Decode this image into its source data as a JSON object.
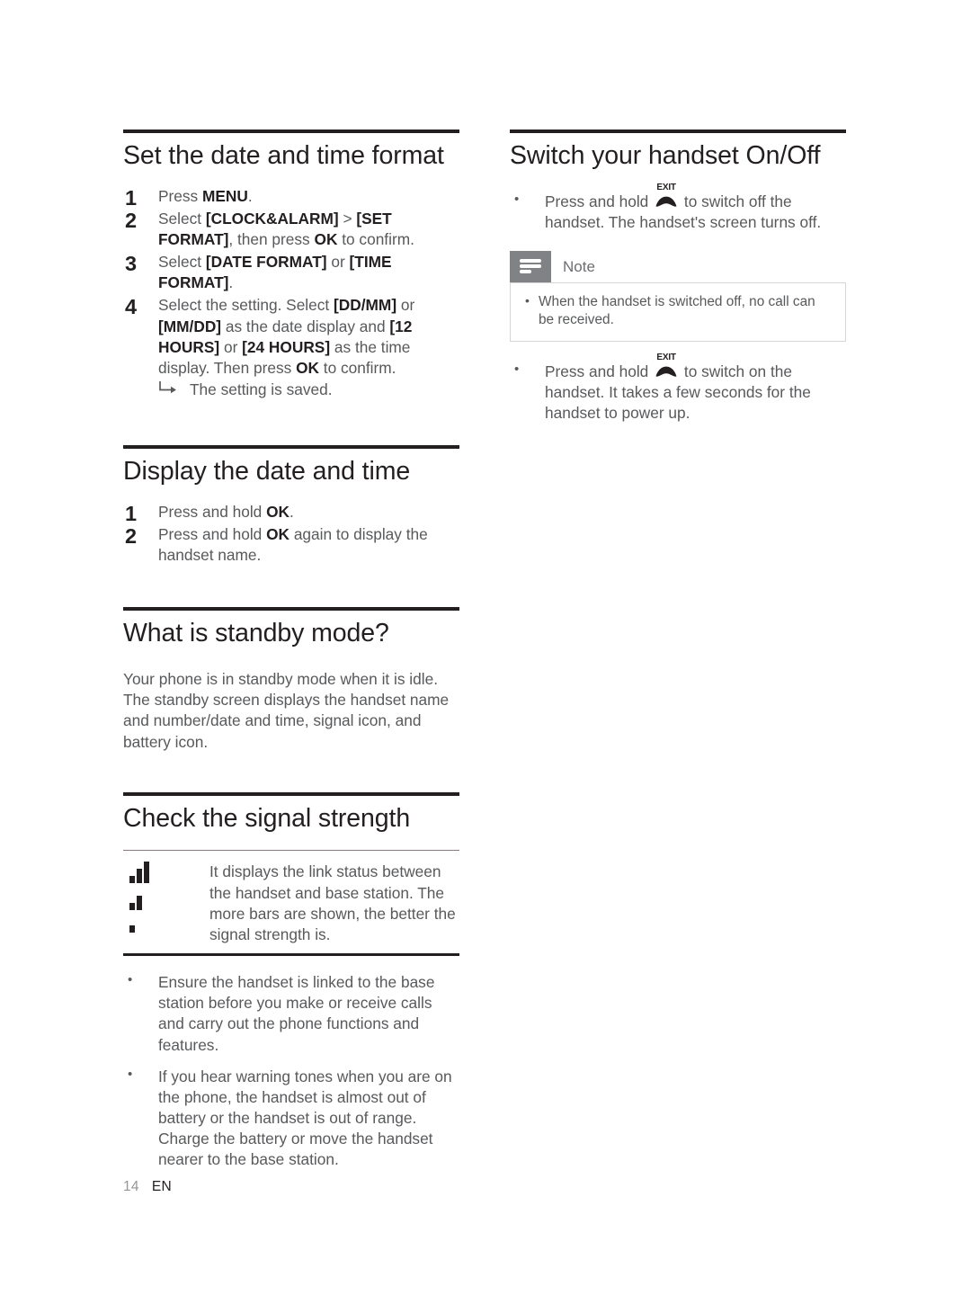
{
  "page": {
    "number": "14",
    "language": "EN"
  },
  "left_column": {
    "sections": [
      {
        "id": "set-date-time-format",
        "heading": "Set the date and time format",
        "steps": [
          {
            "num": "1",
            "parts": [
              {
                "text": "Press ",
                "bold": false
              },
              {
                "text": "MENU",
                "bold": true
              },
              {
                "text": ".",
                "bold": false
              }
            ]
          },
          {
            "num": "2",
            "parts": [
              {
                "text": "Select ",
                "bold": false
              },
              {
                "text": "[CLOCK&ALARM]",
                "bold": true
              },
              {
                "text": " > ",
                "bold": false
              },
              {
                "text": "[SET FORMAT]",
                "bold": true
              },
              {
                "text": ", then press ",
                "bold": false
              },
              {
                "text": "OK",
                "bold": true
              },
              {
                "text": " to confirm.",
                "bold": false
              }
            ]
          },
          {
            "num": "3",
            "parts": [
              {
                "text": "Select ",
                "bold": false
              },
              {
                "text": "[DATE FORMAT]",
                "bold": true
              },
              {
                "text": " or ",
                "bold": false
              },
              {
                "text": "[TIME FORMAT]",
                "bold": true
              },
              {
                "text": ".",
                "bold": false
              }
            ]
          },
          {
            "num": "4",
            "parts": [
              {
                "text": "Select the setting. Select ",
                "bold": false
              },
              {
                "text": "[DD/MM]",
                "bold": true
              },
              {
                "text": " or ",
                "bold": false
              },
              {
                "text": "[MM/DD]",
                "bold": true
              },
              {
                "text": " as the date display and ",
                "bold": false
              },
              {
                "text": "[12 HOURS]",
                "bold": true
              },
              {
                "text": " or ",
                "bold": false
              },
              {
                "text": "[24 HOURS]",
                "bold": true
              },
              {
                "text": " as the time display. Then press ",
                "bold": false
              },
              {
                "text": "OK",
                "bold": true
              },
              {
                "text": " to confirm.",
                "bold": false
              }
            ],
            "result": "The setting is saved."
          }
        ]
      },
      {
        "id": "display-date-time",
        "heading": "Display the date and time",
        "steps": [
          {
            "num": "1",
            "parts": [
              {
                "text": "Press and hold ",
                "bold": false
              },
              {
                "text": "OK",
                "bold": true
              },
              {
                "text": ".",
                "bold": false
              }
            ]
          },
          {
            "num": "2",
            "parts": [
              {
                "text": "Press and hold ",
                "bold": false
              },
              {
                "text": "OK",
                "bold": true
              },
              {
                "text": " again to display the handset name.",
                "bold": false
              }
            ]
          }
        ]
      },
      {
        "id": "standby-mode",
        "heading": "What is standby mode?",
        "paragraph": "Your phone is in standby mode when it is idle. The standby screen displays the handset name and number/date and time, signal icon, and battery icon."
      },
      {
        "id": "check-signal-strength",
        "heading": "Check the signal strength",
        "signal_table": {
          "icons": [
            {
              "name": "signal-strength-3-bars",
              "bars": 3
            },
            {
              "name": "signal-strength-2-bars",
              "bars": 2
            },
            {
              "name": "signal-strength-1-bar",
              "bars": 1
            }
          ],
          "description": "It displays the link status between the handset and base station. The more bars are shown, the better the signal strength is."
        },
        "bullets": [
          "Ensure the handset is linked to the base station before you make or receive calls and carry out the phone functions and features.",
          "If you hear warning tones when you are on the phone, the handset is almost out of battery or the handset is out of range. Charge the battery or move the handset nearer to the base station."
        ]
      }
    ]
  },
  "right_column": {
    "sections": [
      {
        "id": "switch-handset-on-off",
        "heading": "Switch your handset On/Off",
        "bullet_off": {
          "lead": "Press and hold ",
          "key_label": "EXIT",
          "tail": " to switch off the handset. The handset's screen turns off."
        },
        "note": {
          "title": "Note",
          "icon": "note-lines-icon",
          "items": [
            "When the handset is switched off, no call can be received."
          ]
        },
        "bullet_on": {
          "lead": "Press and hold ",
          "key_label": "EXIT",
          "tail": " to switch on the handset. It takes a few seconds for the handset to power up."
        }
      }
    ]
  },
  "colors": {
    "heading": "#231f20",
    "body_text": "#58595b",
    "rule": "#231f20",
    "note_tab": "#808285",
    "note_border": "#d6d6d6",
    "table_top_rule": "#8c7b7f",
    "page_number": "#939598"
  }
}
